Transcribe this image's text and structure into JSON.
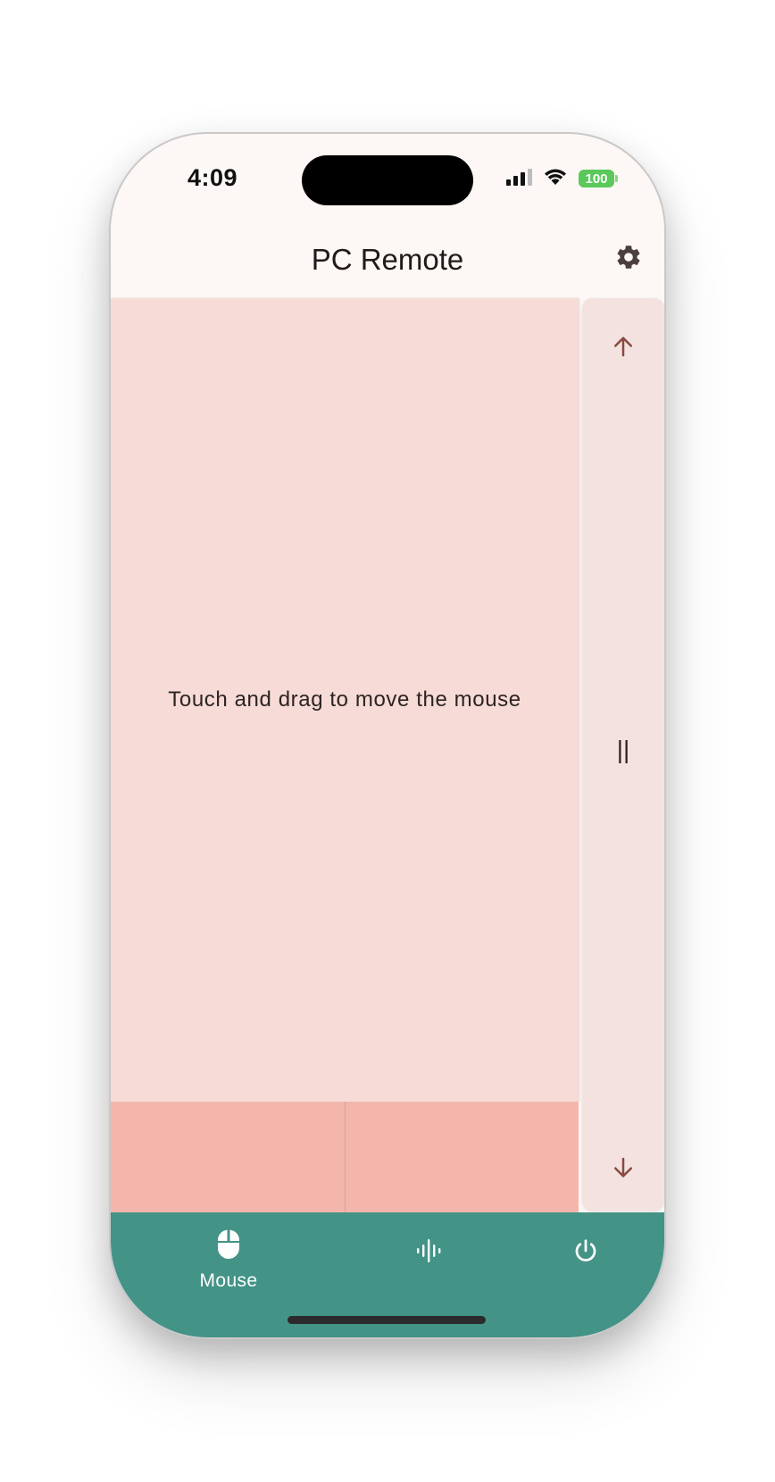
{
  "status_bar": {
    "time": "4:09",
    "battery": "100"
  },
  "app_bar": {
    "title": "PC Remote",
    "settings_icon": "gear-icon"
  },
  "touchpad": {
    "hint": "Touch and drag to move the mouse"
  },
  "scroll_strip": {
    "up_icon": "arrow-up-icon",
    "handle": "||",
    "down_icon": "arrow-down-icon"
  },
  "bottom_nav": {
    "items": [
      {
        "label": "Mouse",
        "icon": "mouse-icon",
        "selected": true
      },
      {
        "label": "",
        "icon": "audio-waveform-icon",
        "selected": false
      },
      {
        "label": "",
        "icon": "power-icon",
        "selected": false
      }
    ]
  },
  "colors": {
    "touchpad": "#f6dbd7",
    "mouse_buttons": "#f4b6ab",
    "scroll_strip": "#f3e2e0",
    "nav_bar": "#439387",
    "arrow": "#8a4a3f"
  }
}
